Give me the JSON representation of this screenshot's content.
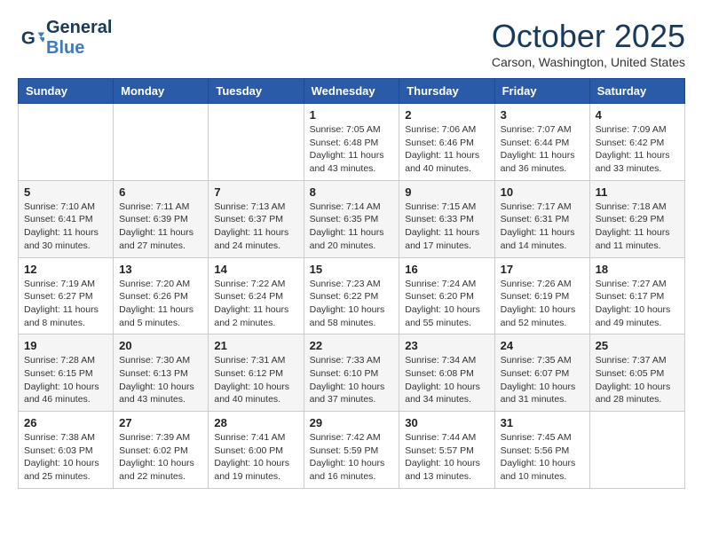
{
  "header": {
    "logo_line1": "General",
    "logo_line2": "Blue",
    "month_title": "October 2025",
    "location": "Carson, Washington, United States"
  },
  "days_of_week": [
    "Sunday",
    "Monday",
    "Tuesday",
    "Wednesday",
    "Thursday",
    "Friday",
    "Saturday"
  ],
  "weeks": [
    [
      {
        "day": "",
        "info": ""
      },
      {
        "day": "",
        "info": ""
      },
      {
        "day": "",
        "info": ""
      },
      {
        "day": "1",
        "info": "Sunrise: 7:05 AM\nSunset: 6:48 PM\nDaylight: 11 hours\nand 43 minutes."
      },
      {
        "day": "2",
        "info": "Sunrise: 7:06 AM\nSunset: 6:46 PM\nDaylight: 11 hours\nand 40 minutes."
      },
      {
        "day": "3",
        "info": "Sunrise: 7:07 AM\nSunset: 6:44 PM\nDaylight: 11 hours\nand 36 minutes."
      },
      {
        "day": "4",
        "info": "Sunrise: 7:09 AM\nSunset: 6:42 PM\nDaylight: 11 hours\nand 33 minutes."
      }
    ],
    [
      {
        "day": "5",
        "info": "Sunrise: 7:10 AM\nSunset: 6:41 PM\nDaylight: 11 hours\nand 30 minutes."
      },
      {
        "day": "6",
        "info": "Sunrise: 7:11 AM\nSunset: 6:39 PM\nDaylight: 11 hours\nand 27 minutes."
      },
      {
        "day": "7",
        "info": "Sunrise: 7:13 AM\nSunset: 6:37 PM\nDaylight: 11 hours\nand 24 minutes."
      },
      {
        "day": "8",
        "info": "Sunrise: 7:14 AM\nSunset: 6:35 PM\nDaylight: 11 hours\nand 20 minutes."
      },
      {
        "day": "9",
        "info": "Sunrise: 7:15 AM\nSunset: 6:33 PM\nDaylight: 11 hours\nand 17 minutes."
      },
      {
        "day": "10",
        "info": "Sunrise: 7:17 AM\nSunset: 6:31 PM\nDaylight: 11 hours\nand 14 minutes."
      },
      {
        "day": "11",
        "info": "Sunrise: 7:18 AM\nSunset: 6:29 PM\nDaylight: 11 hours\nand 11 minutes."
      }
    ],
    [
      {
        "day": "12",
        "info": "Sunrise: 7:19 AM\nSunset: 6:27 PM\nDaylight: 11 hours\nand 8 minutes."
      },
      {
        "day": "13",
        "info": "Sunrise: 7:20 AM\nSunset: 6:26 PM\nDaylight: 11 hours\nand 5 minutes."
      },
      {
        "day": "14",
        "info": "Sunrise: 7:22 AM\nSunset: 6:24 PM\nDaylight: 11 hours\nand 2 minutes."
      },
      {
        "day": "15",
        "info": "Sunrise: 7:23 AM\nSunset: 6:22 PM\nDaylight: 10 hours\nand 58 minutes."
      },
      {
        "day": "16",
        "info": "Sunrise: 7:24 AM\nSunset: 6:20 PM\nDaylight: 10 hours\nand 55 minutes."
      },
      {
        "day": "17",
        "info": "Sunrise: 7:26 AM\nSunset: 6:19 PM\nDaylight: 10 hours\nand 52 minutes."
      },
      {
        "day": "18",
        "info": "Sunrise: 7:27 AM\nSunset: 6:17 PM\nDaylight: 10 hours\nand 49 minutes."
      }
    ],
    [
      {
        "day": "19",
        "info": "Sunrise: 7:28 AM\nSunset: 6:15 PM\nDaylight: 10 hours\nand 46 minutes."
      },
      {
        "day": "20",
        "info": "Sunrise: 7:30 AM\nSunset: 6:13 PM\nDaylight: 10 hours\nand 43 minutes."
      },
      {
        "day": "21",
        "info": "Sunrise: 7:31 AM\nSunset: 6:12 PM\nDaylight: 10 hours\nand 40 minutes."
      },
      {
        "day": "22",
        "info": "Sunrise: 7:33 AM\nSunset: 6:10 PM\nDaylight: 10 hours\nand 37 minutes."
      },
      {
        "day": "23",
        "info": "Sunrise: 7:34 AM\nSunset: 6:08 PM\nDaylight: 10 hours\nand 34 minutes."
      },
      {
        "day": "24",
        "info": "Sunrise: 7:35 AM\nSunset: 6:07 PM\nDaylight: 10 hours\nand 31 minutes."
      },
      {
        "day": "25",
        "info": "Sunrise: 7:37 AM\nSunset: 6:05 PM\nDaylight: 10 hours\nand 28 minutes."
      }
    ],
    [
      {
        "day": "26",
        "info": "Sunrise: 7:38 AM\nSunset: 6:03 PM\nDaylight: 10 hours\nand 25 minutes."
      },
      {
        "day": "27",
        "info": "Sunrise: 7:39 AM\nSunset: 6:02 PM\nDaylight: 10 hours\nand 22 minutes."
      },
      {
        "day": "28",
        "info": "Sunrise: 7:41 AM\nSunset: 6:00 PM\nDaylight: 10 hours\nand 19 minutes."
      },
      {
        "day": "29",
        "info": "Sunrise: 7:42 AM\nSunset: 5:59 PM\nDaylight: 10 hours\nand 16 minutes."
      },
      {
        "day": "30",
        "info": "Sunrise: 7:44 AM\nSunset: 5:57 PM\nDaylight: 10 hours\nand 13 minutes."
      },
      {
        "day": "31",
        "info": "Sunrise: 7:45 AM\nSunset: 5:56 PM\nDaylight: 10 hours\nand 10 minutes."
      },
      {
        "day": "",
        "info": ""
      }
    ]
  ]
}
